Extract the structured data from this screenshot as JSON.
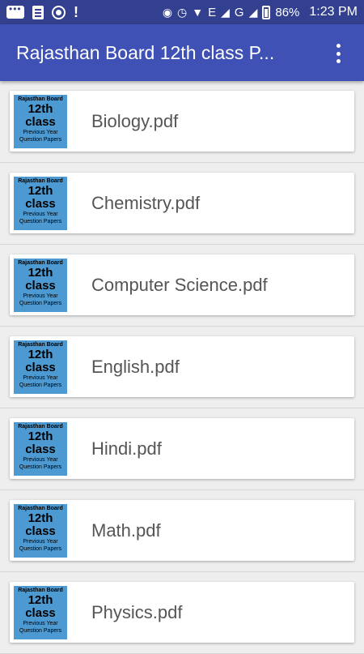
{
  "status_bar": {
    "battery": "86%",
    "time": "1:23 PM",
    "network": "E",
    "network2": "G"
  },
  "app_bar": {
    "title": "Rajasthan Board 12th class P..."
  },
  "thumbnail": {
    "line1": "Rajasthan Board",
    "line2": "12th",
    "line3": "class",
    "line4": "Previous Year",
    "line5": "Question Papers"
  },
  "files": [
    {
      "name": "Biology.pdf"
    },
    {
      "name": "Chemistry.pdf"
    },
    {
      "name": "Computer Science.pdf"
    },
    {
      "name": "English.pdf"
    },
    {
      "name": "Hindi.pdf"
    },
    {
      "name": "Math.pdf"
    },
    {
      "name": "Physics.pdf"
    }
  ],
  "colors": {
    "status_bar": "#33408f",
    "app_bar": "#3f51b5",
    "thumbnail": "#4d9ad3"
  }
}
